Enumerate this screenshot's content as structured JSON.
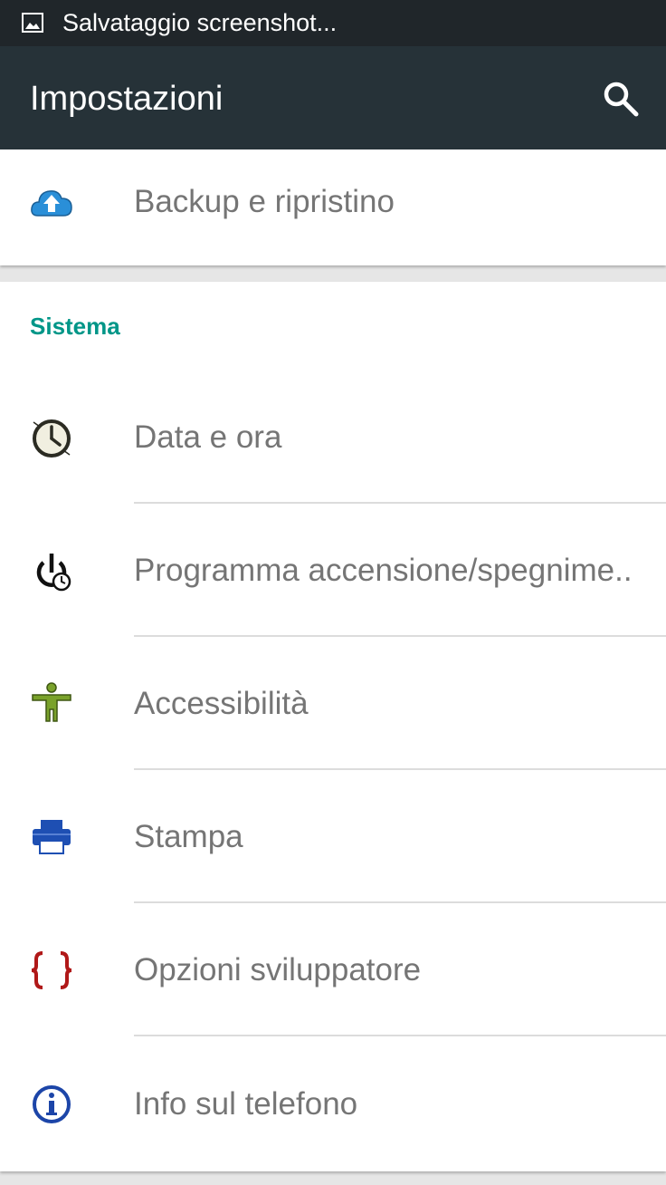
{
  "status_bar": {
    "text": "Salvataggio screenshot...",
    "icon": "image-icon"
  },
  "app_bar": {
    "title": "Impostazioni",
    "search_icon": "search-icon"
  },
  "top_item": {
    "label": "Backup e ripristino",
    "icon": "cloud-upload-icon"
  },
  "section": {
    "header": "Sistema",
    "header_color": "#009688",
    "items": [
      {
        "label": "Data e ora",
        "icon": "clock-icon"
      },
      {
        "label": "Programma accensione/spegnime..",
        "icon": "power-schedule-icon"
      },
      {
        "label": "Accessibilità",
        "icon": "accessibility-icon"
      },
      {
        "label": "Stampa",
        "icon": "printer-icon"
      },
      {
        "label": "Opzioni sviluppatore",
        "icon": "braces-icon"
      },
      {
        "label": "Info sul telefono",
        "icon": "info-icon"
      }
    ]
  },
  "colors": {
    "status_bar": "#20262a",
    "app_bar": "#263238",
    "label": "#757575",
    "background": "#e6e6e6"
  }
}
